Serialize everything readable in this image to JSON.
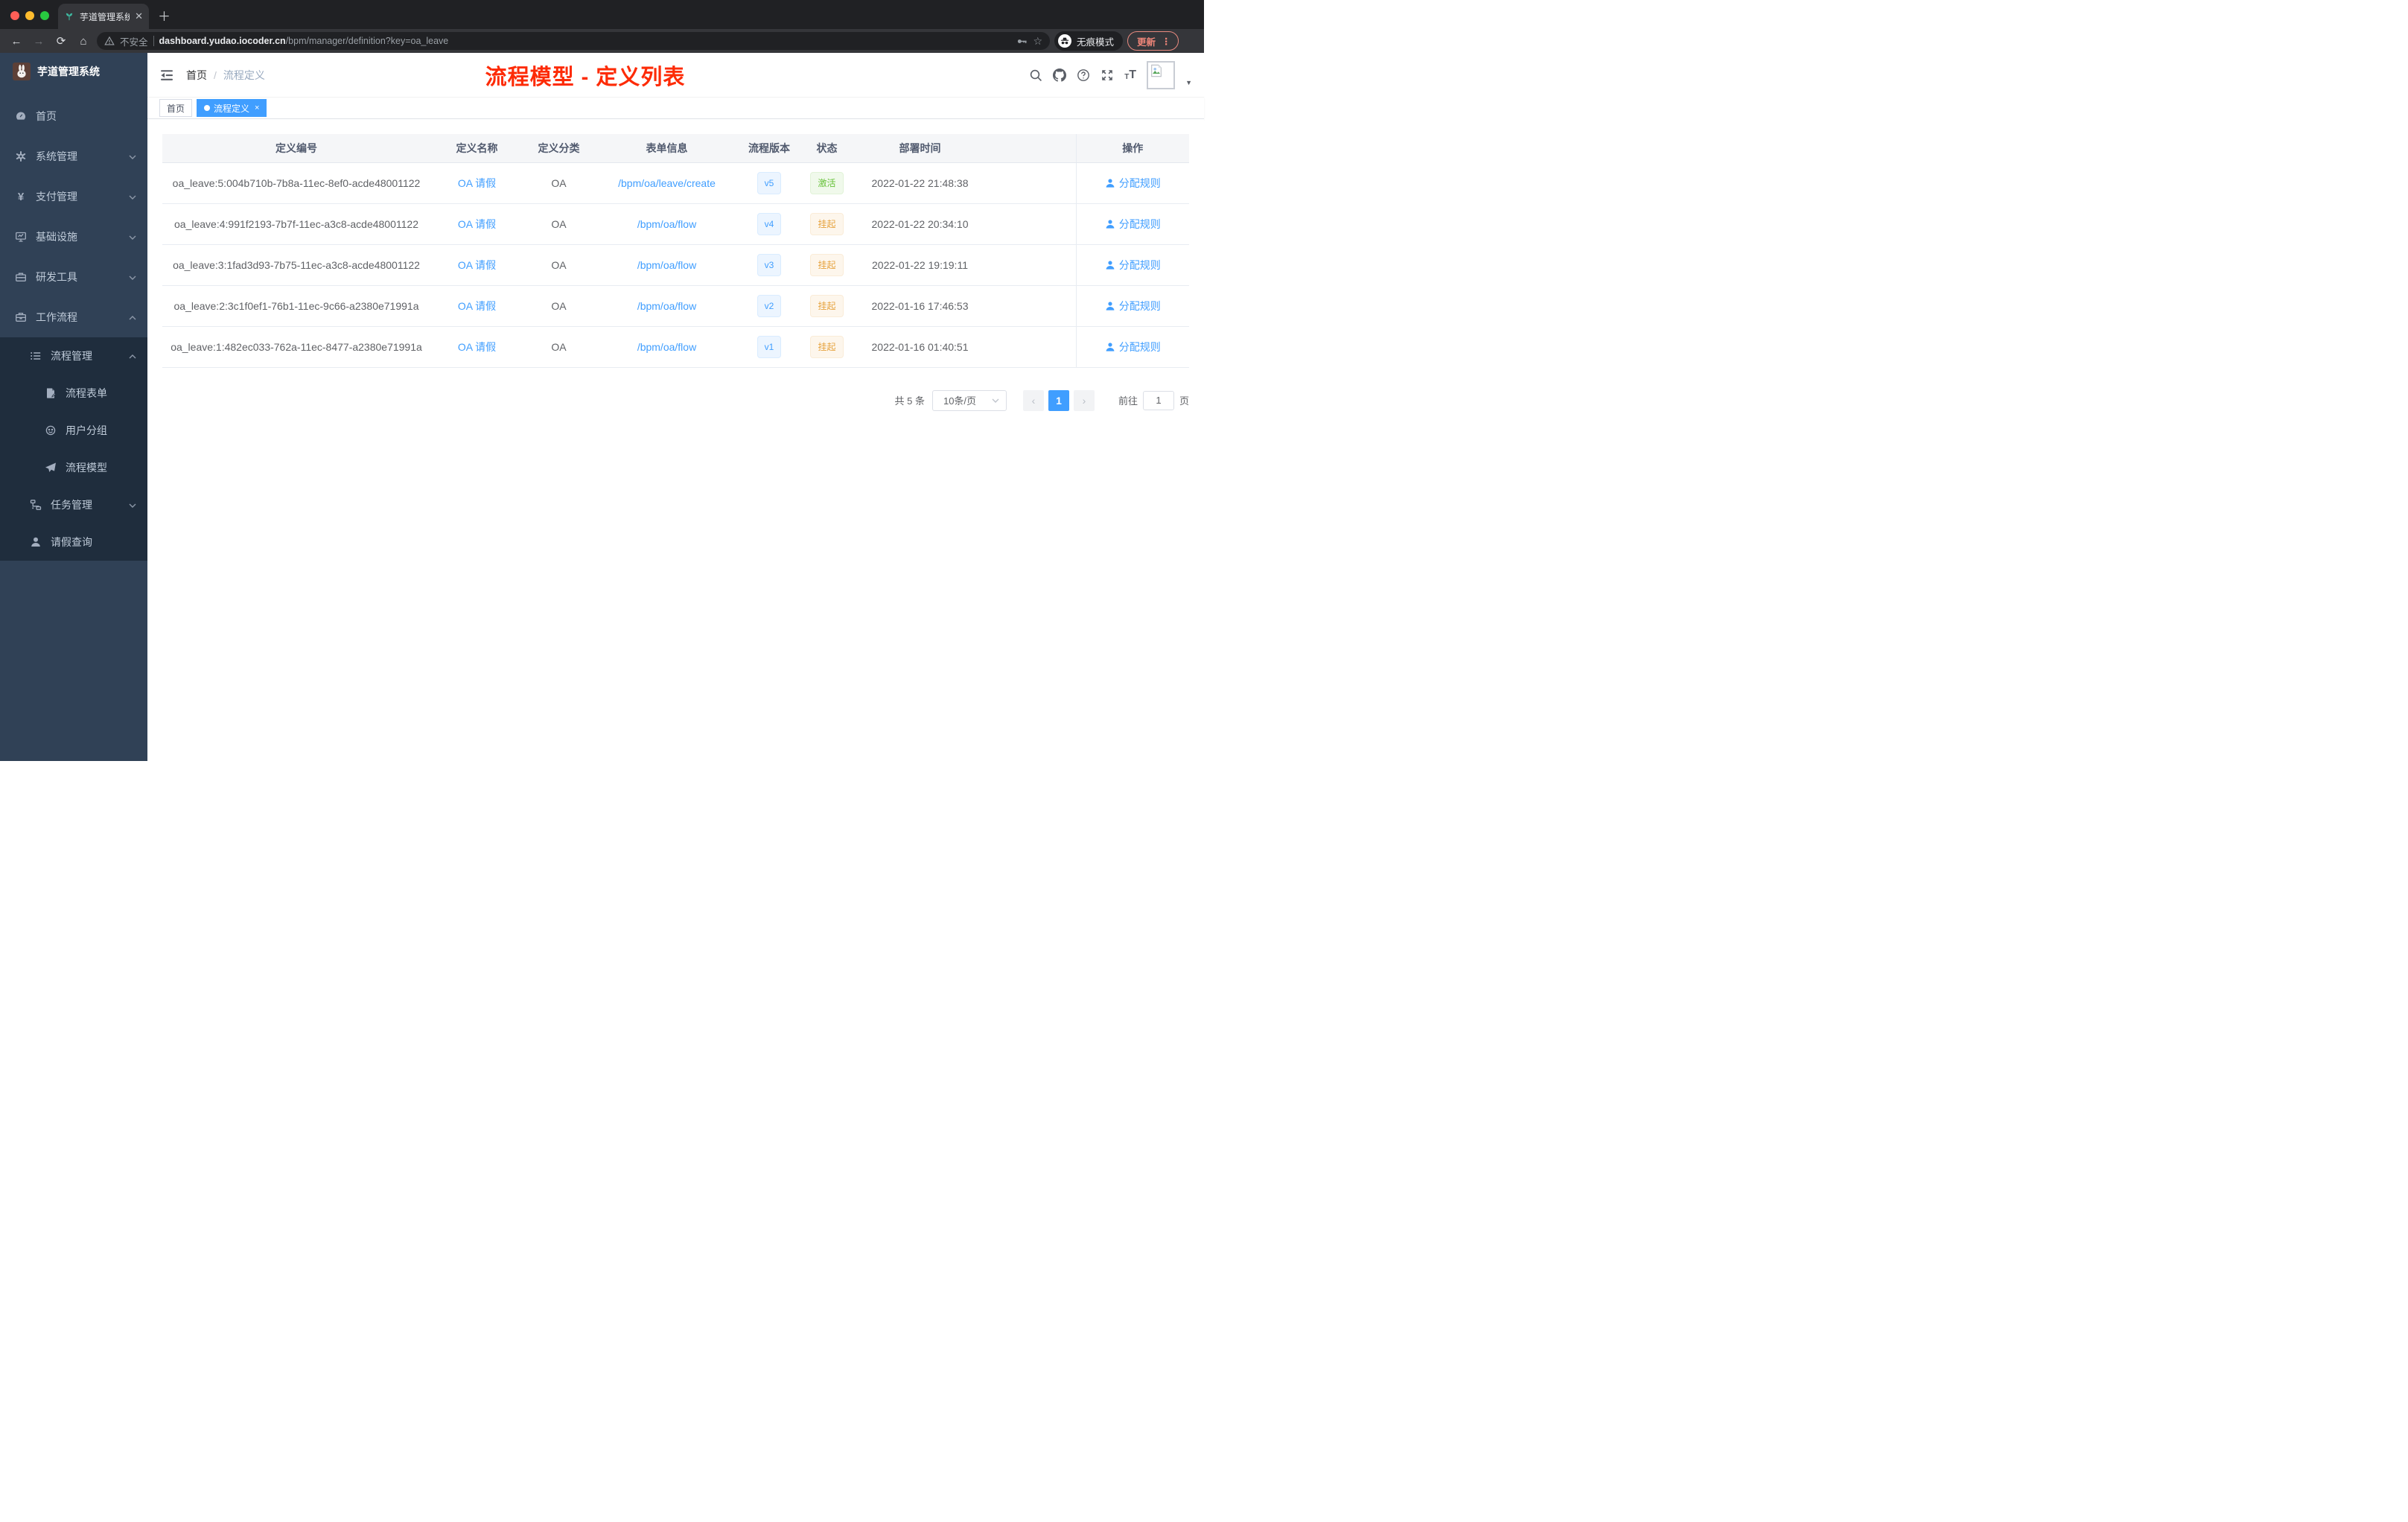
{
  "browser": {
    "tab_title": "芋道管理系统",
    "security_label": "不安全",
    "url_host": "dashboard.yudao.iocoder.cn",
    "url_path": "/bpm/manager/definition?key=oa_leave",
    "incognito_label": "无痕模式",
    "update_label": "更新"
  },
  "sidebar": {
    "logo_title": "芋道管理系统",
    "items": [
      {
        "label": "首页",
        "icon": "dashboard-icon"
      },
      {
        "label": "系统管理",
        "icon": "gear-icon",
        "chevron": "down"
      },
      {
        "label": "支付管理",
        "icon": "yen-icon",
        "chevron": "down"
      },
      {
        "label": "基础设施",
        "icon": "monitor-icon",
        "chevron": "down"
      },
      {
        "label": "研发工具",
        "icon": "toolbox-icon",
        "chevron": "down"
      },
      {
        "label": "工作流程",
        "icon": "briefcase-icon",
        "chevron": "up"
      },
      {
        "label": "流程管理",
        "icon": "list-icon",
        "chevron": "up"
      },
      {
        "label": "流程表单",
        "icon": "form-icon"
      },
      {
        "label": "用户分组",
        "icon": "group-icon"
      },
      {
        "label": "流程模型",
        "icon": "paper-plane-icon"
      },
      {
        "label": "任务管理",
        "icon": "tree-icon",
        "chevron": "down"
      },
      {
        "label": "请假查询",
        "icon": "user-icon"
      }
    ]
  },
  "navbar": {
    "breadcrumb_home": "首页",
    "breadcrumb_sep": "/",
    "breadcrumb_current": "流程定义",
    "annotation": "流程模型 - 定义列表"
  },
  "tags": {
    "home": "首页",
    "current": "流程定义",
    "close_glyph": "×"
  },
  "table": {
    "columns": [
      "定义编号",
      "定义名称",
      "定义分类",
      "表单信息",
      "流程版本",
      "状态",
      "部署时间",
      "操作"
    ],
    "rows": [
      {
        "id": "oa_leave:5:004b710b-7b8a-11ec-8ef0-acde48001122",
        "name": "OA 请假",
        "category": "OA",
        "form": "/bpm/oa/leave/create",
        "version": "v5",
        "status": "激活",
        "deployed_at": "2022-01-22 21:48:38",
        "action": "分配规则"
      },
      {
        "id": "oa_leave:4:991f2193-7b7f-11ec-a3c8-acde48001122",
        "name": "OA 请假",
        "category": "OA",
        "form": "/bpm/oa/flow",
        "version": "v4",
        "status": "挂起",
        "deployed_at": "2022-01-22 20:34:10",
        "action": "分配规则"
      },
      {
        "id": "oa_leave:3:1fad3d93-7b75-11ec-a3c8-acde48001122",
        "name": "OA 请假",
        "category": "OA",
        "form": "/bpm/oa/flow",
        "version": "v3",
        "status": "挂起",
        "deployed_at": "2022-01-22 19:19:11",
        "action": "分配规则"
      },
      {
        "id": "oa_leave:2:3c1f0ef1-76b1-11ec-9c66-a2380e71991a",
        "name": "OA 请假",
        "category": "OA",
        "form": "/bpm/oa/flow",
        "version": "v2",
        "status": "挂起",
        "deployed_at": "2022-01-16 17:46:53",
        "action": "分配规则"
      },
      {
        "id": "oa_leave:1:482ec033-762a-11ec-8477-a2380e71991a",
        "name": "OA 请假",
        "category": "OA",
        "form": "/bpm/oa/flow",
        "version": "v1",
        "status": "挂起",
        "deployed_at": "2022-01-16 01:40:51",
        "action": "分配规则"
      }
    ]
  },
  "pagination": {
    "total_label": "共 5 条",
    "page_size": "10条/页",
    "prev_glyph": "‹",
    "current_page": "1",
    "next_glyph": "›",
    "goto_label": "前往",
    "goto_value": "1",
    "goto_suffix": "页"
  },
  "colors": {
    "accent_blue": "#409eff",
    "success_green": "#67c23a",
    "warning_orange": "#e6a23c",
    "annotation_red": "#fd2b06",
    "sidebar_bg": "#304156",
    "submenu_bg": "#1f2d3d",
    "chrome_bg": "#202124",
    "toolbar_bg": "#35363a"
  }
}
